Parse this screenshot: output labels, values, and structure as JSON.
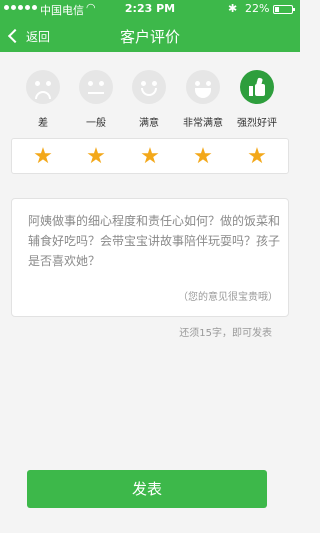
{
  "status_bar": {
    "carrier": "中国电信",
    "time": "2:23 PM",
    "battery": "22%",
    "battery_level": 0.22
  },
  "header": {
    "back_label": "返回",
    "title": "客户评价"
  },
  "rating_levels": [
    {
      "label": "差",
      "icon": "frown-face-icon"
    },
    {
      "label": "一般",
      "icon": "neutral-face-icon"
    },
    {
      "label": "满意",
      "icon": "smile-face-icon"
    },
    {
      "label": "非常满意",
      "icon": "laughing-face-icon"
    },
    {
      "label": "强烈好评",
      "icon": "thumbs-up-icon"
    }
  ],
  "selected_level": 5,
  "stars": {
    "value": 5,
    "max": 5
  },
  "review": {
    "prompt": "阿姨做事的细心程度和责任心如何？做的饭菜和辅食好吃吗？会带宝宝讲故事陪伴玩耍吗？孩子是否喜欢她？",
    "hint": "（您的意见很宝贵哦）"
  },
  "char_tip": "还须15字，即可发表",
  "submit_label": "发表",
  "colors": {
    "accent": "#3db84a",
    "star": "#f3a81a",
    "face_inactive": "#e6e6e6"
  }
}
